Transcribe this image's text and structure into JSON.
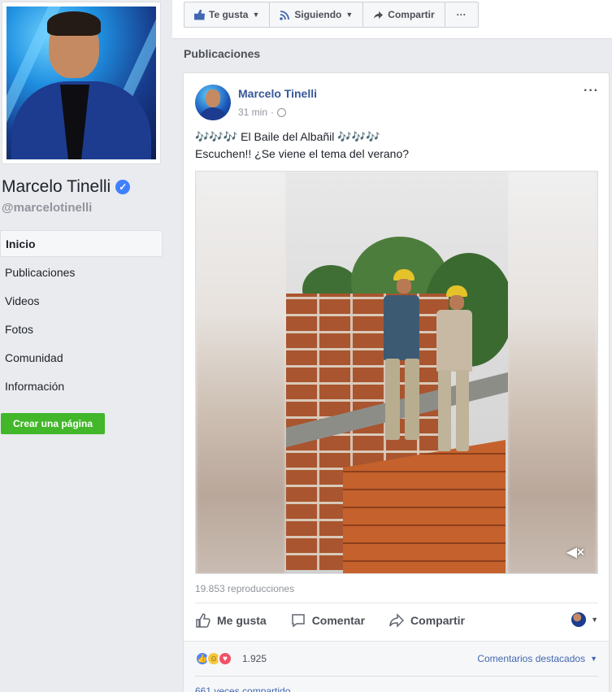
{
  "colors": {
    "brand_blue": "#4267b2",
    "link_blue": "#365899",
    "create_green": "#42b72a",
    "page_bg": "#e9ebee"
  },
  "page": {
    "name": "Marcelo Tinelli",
    "handle": "@marcelotinelli",
    "verified": true
  },
  "nav": {
    "items": [
      {
        "label": "Inicio",
        "active": true
      },
      {
        "label": "Publicaciones",
        "active": false
      },
      {
        "label": "Videos",
        "active": false
      },
      {
        "label": "Fotos",
        "active": false
      },
      {
        "label": "Comunidad",
        "active": false
      },
      {
        "label": "Información",
        "active": false
      }
    ],
    "create_page": "Crear una página"
  },
  "actions": {
    "like": "Te gusta",
    "follow": "Siguiendo",
    "share": "Compartir",
    "more": "···"
  },
  "section_title": "Publicaciones",
  "post": {
    "author": "Marcelo Tinelli",
    "time": "31 min",
    "dot": "·",
    "line1": "🎶🎶🎶 El Baile del Albañil 🎶🎶🎶",
    "line2": "Escuchen!! ¿Se viene el tema del verano?",
    "views": "19.853 reproducciones",
    "buttons": {
      "like": "Me gusta",
      "comment": "Comentar",
      "share": "Compartir"
    },
    "reaction_count": "1.925",
    "top_comments": "Comentarios destacados",
    "shares": "661 veces compartido",
    "icons": [
      "globe-icon",
      "more-icon",
      "mute-icon",
      "like-icon",
      "comment-icon",
      "share-icon"
    ]
  }
}
